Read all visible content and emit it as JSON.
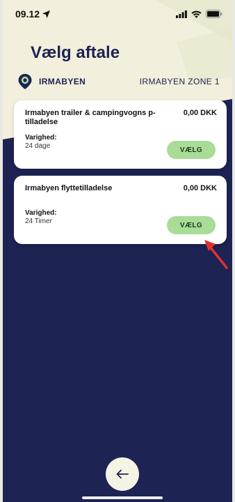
{
  "status_bar": {
    "time": "09.12"
  },
  "header": {
    "title": "Vælg aftale"
  },
  "location": {
    "name": "IRMABYEN",
    "zone": "IRMABYEN ZONE 1"
  },
  "agreements": [
    {
      "name": "Irmabyen trailer & campingvogns p-tilladelse",
      "price": "0,00 DKK",
      "duration_label": "Varighed:",
      "duration": "24 dage",
      "button": "VÆLG"
    },
    {
      "name": "Irmabyen flyttetilladelse",
      "price": "0,00 DKK",
      "duration_label": "Varighed:",
      "duration": "24 Timer",
      "button": "VÆLG"
    }
  ],
  "colors": {
    "navy": "#1d2352",
    "cream": "#f2efdc",
    "green_button": "#a8dc97",
    "annotation_red": "#e0312b"
  },
  "icons": {
    "back": "arrow-left-icon",
    "location": "location-pin-icon"
  }
}
